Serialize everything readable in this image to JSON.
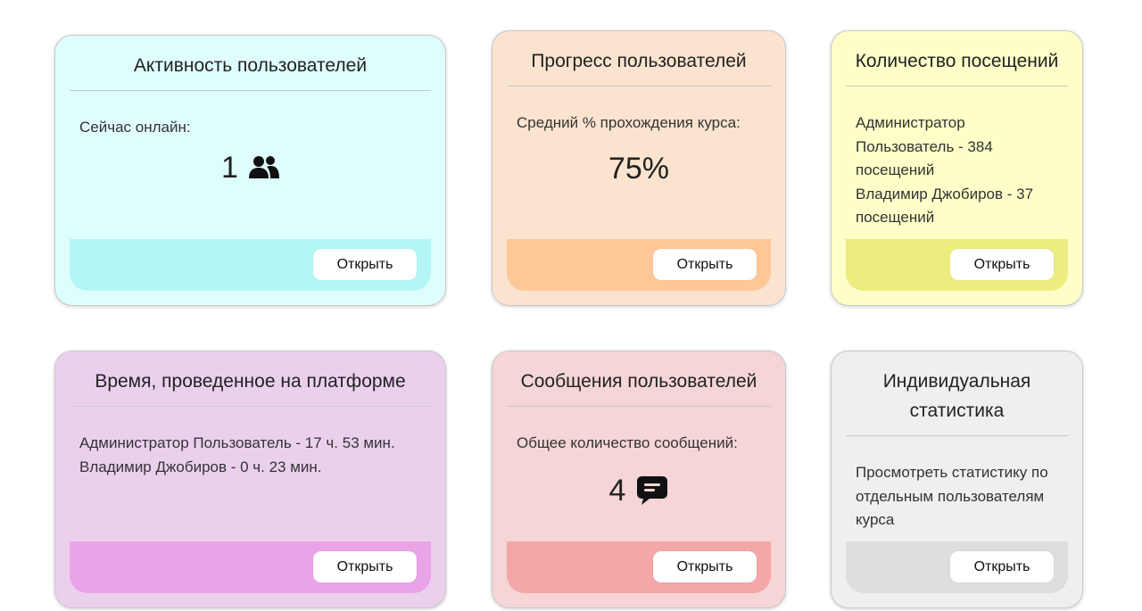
{
  "colors": {
    "activity_bg": "#dffdfd",
    "activity_footer": "#b4f6f6",
    "progress_bg": "#fbe4cf",
    "progress_footer": "#fdc797",
    "visits_bg": "#fefec8",
    "visits_footer": "#edec7e",
    "time_bg": "#ebd0ee",
    "time_footer": "#eba3e8",
    "messages_bg": "#f5d5d5",
    "messages_footer": "#f4a7a7",
    "individual_bg": "#efefef",
    "individual_footer": "#dedede"
  },
  "cards": {
    "activity": {
      "title": "Активность пользователей",
      "label": "Сейчас онлайн:",
      "value": "1",
      "icon": "users-icon",
      "button": "Открыть"
    },
    "progress": {
      "title": "Прогресс пользователей",
      "label": "Средний % прохождения курса:",
      "value": "75%",
      "button": "Открыть"
    },
    "visits": {
      "title": "Количество посещений",
      "lines": [
        "Администратор",
        "Пользователь - 384",
        "посещений",
        "Владимир Джобиров - 37",
        "посещений"
      ],
      "button": "Открыть"
    },
    "time": {
      "title": "Время, проведенное на платформе",
      "lines": [
        "Администратор Пользователь - 17 ч. 53 мин.",
        "Владимир Джобиров - 0 ч. 23 мин."
      ],
      "button": "Открыть"
    },
    "messages": {
      "title": "Сообщения пользователей",
      "label": "Общее количество сообщений:",
      "value": "4",
      "icon": "message-icon",
      "button": "Открыть"
    },
    "individual": {
      "title_line1": "Индивидуальная",
      "title_line2": "статистика",
      "lines": [
        "Просмотреть статистику по",
        "отдельным пользователям",
        "курса"
      ],
      "button": "Открыть"
    }
  }
}
